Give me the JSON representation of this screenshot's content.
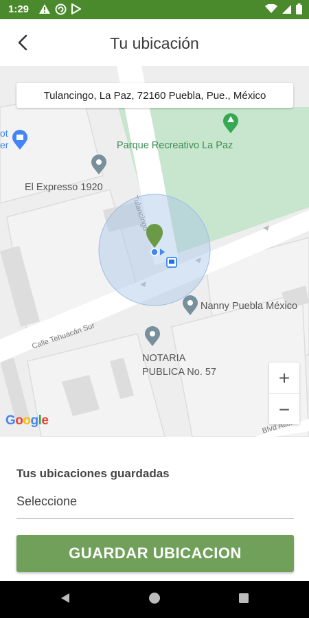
{
  "status_bar": {
    "time": "1:29",
    "icons": [
      "warning-icon",
      "vpn-icon",
      "play-icon"
    ],
    "right_icons": [
      "wifi-icon",
      "signal-icon",
      "battery-icon"
    ]
  },
  "app_bar": {
    "title": "Tu ubicación",
    "back_icon": "arrow-back-icon"
  },
  "map": {
    "address": "Tulancingo, La Paz, 72160 Puebla, Pue., México",
    "pois": [
      {
        "label": "Parque Recreativo La Paz",
        "icon": "park-pin-icon"
      },
      {
        "label": "El Expresso 1920",
        "icon": "place-pin-icon"
      },
      {
        "label": "Nanny Puebla México",
        "icon": "place-pin-icon"
      },
      {
        "label": "NOTARIA PUBLICA No. 57",
        "icon": "place-pin-icon"
      },
      {
        "label": "ot er",
        "icon": "shop-icon"
      }
    ],
    "streets": [
      "Tulancingo",
      "Calle Tehuacán Sur",
      "Blvd Atlixco"
    ],
    "notaria_line1": "NOTARIA",
    "notaria_line2": "PUBLICA No. 57",
    "zoom_in": "+",
    "zoom_out": "−",
    "logo": "Google",
    "colors": {
      "park": "#c7e6cd",
      "accuracy": "#a9c5e8",
      "marker": "#6b9a47",
      "location_dot": "#4285f4"
    }
  },
  "saved_locations": {
    "label": "Tus ubicaciones guardadas",
    "placeholder": "Seleccione"
  },
  "save_button": {
    "label": "GUARDAR UBICACION",
    "color": "#70a05a"
  },
  "nav_bar": {
    "icons": [
      "back-triangle-icon",
      "home-circle-icon",
      "recents-square-icon"
    ]
  }
}
